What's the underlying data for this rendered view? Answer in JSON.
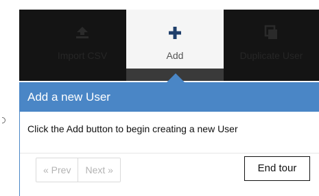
{
  "toolbar": {
    "import_label": "Import CSV",
    "add_label": "Add",
    "duplicate_label": "Duplicate User"
  },
  "icons": {
    "import": "upload-icon",
    "add": "plus-icon",
    "duplicate": "copy-icon"
  },
  "colors": {
    "toolbar_bg": "#141414",
    "popover_header": "#4a86c6",
    "add_icon": "#1f3f6b"
  },
  "tour": {
    "title": "Add a new User",
    "body": "Click the Add button to begin creating a new User",
    "prev_label": "« Prev",
    "next_label": "Next »",
    "end_label": "End tour"
  }
}
